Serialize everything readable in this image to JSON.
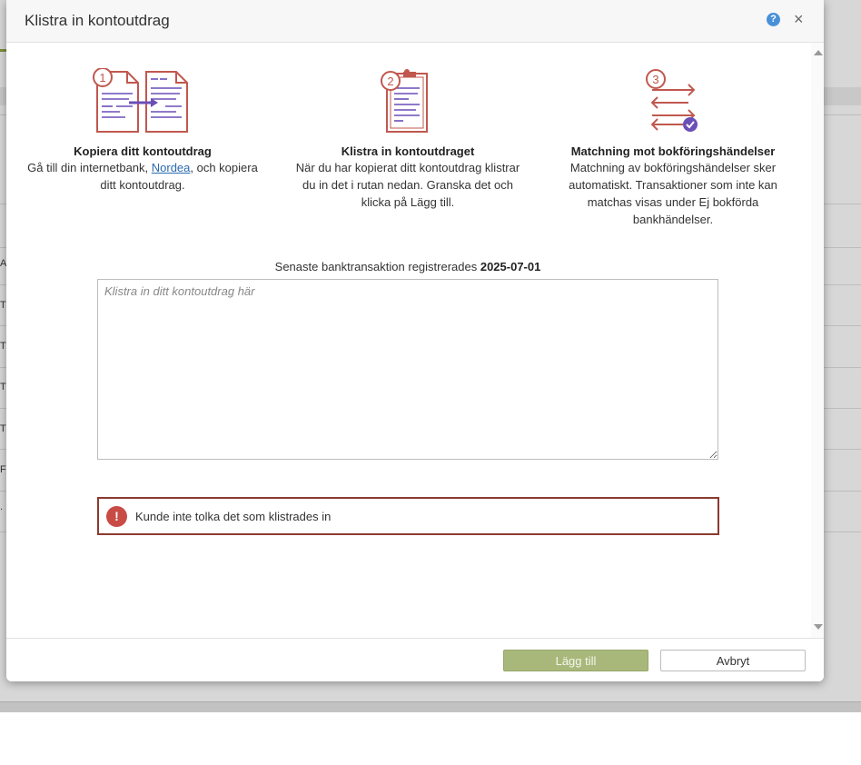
{
  "background": {
    "row_letters": [
      "A",
      "T",
      "T",
      "T",
      "T",
      "F",
      "."
    ]
  },
  "dialog": {
    "title": "Klistra in kontoutdrag",
    "help_label": "?",
    "close_label": "×"
  },
  "steps": [
    {
      "number": "1",
      "title": "Kopiera ditt kontoutdrag",
      "text_before": "Gå till din internetbank, ",
      "link": "Nordea",
      "text_after": ", och kopiera ditt kontoutdrag."
    },
    {
      "number": "2",
      "title": "Klistra in kontoutdraget",
      "text": "När du har kopierat ditt kontoutdrag klistrar du in det i rutan nedan. Granska det och klicka på Lägg till."
    },
    {
      "number": "3",
      "title": "Matchning mot bokföringshändelser",
      "text": "Matchning av bokföringshändelser sker automatiskt. Transaktioner som inte kan matchas visas under Ej bokförda bankhändelser."
    }
  ],
  "last_transaction": {
    "label": "Senaste banktransaktion registrerades ",
    "date": "2025-07-01"
  },
  "paste_area": {
    "placeholder": "Klistra in ditt kontoutdrag här",
    "value": ""
  },
  "error": {
    "icon": "!",
    "message": "Kunde inte tolka det som klistrades in"
  },
  "footer": {
    "add_label": "Lägg till",
    "cancel_label": "Avbryt"
  },
  "colors": {
    "accent_icon": "#c0584f",
    "accent_lines": "#6a4fb8",
    "error_border": "#8b3a2e",
    "add_button": "#a8b87a"
  }
}
